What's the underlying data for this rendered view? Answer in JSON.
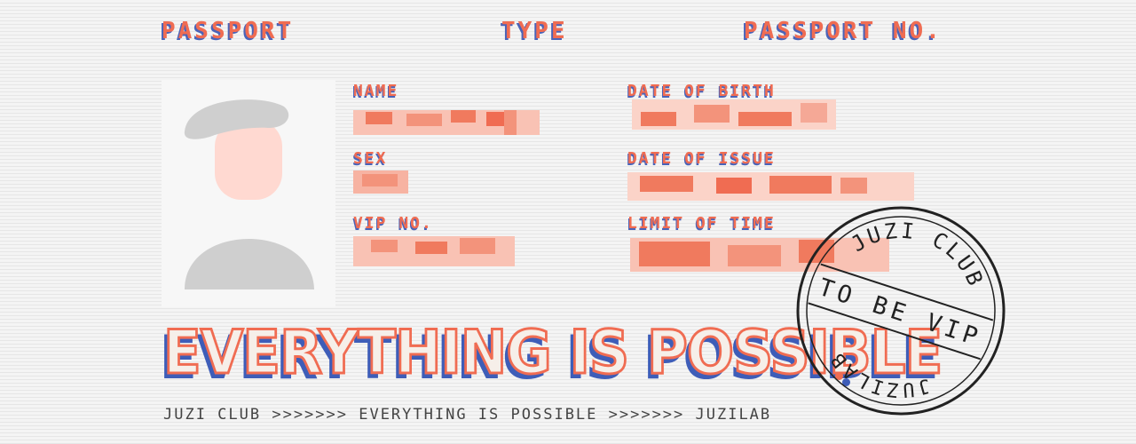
{
  "header": {
    "passport_label": "PASSPORT",
    "type_label": "TYPE",
    "passport_no_label": "PASSPORT NO."
  },
  "fields": {
    "name": "NAME",
    "sex": "SEX",
    "vip_no": "VIP NO.",
    "date_of_birth": "DATE OF BIRTH",
    "date_of_issue": "DATE OF ISSUE",
    "limit_of_time": "LIMIT OF TIME"
  },
  "slogan": "EVERYTHING IS POSSIBLE",
  "footer": "JUZI CLUB >>>>>>> EVERYTHING IS POSSIBLE >>>>>>> JUZILAB",
  "stamp": {
    "top_text": "JUZI CLUB",
    "band_text": "TO BE VIP",
    "bottom_text": "JUZILAB"
  },
  "colors": {
    "accent": "#f06c52",
    "shadow": "#4a63b8",
    "stamp": "#222222"
  },
  "icons": {
    "avatar": "person-silhouette-icon"
  }
}
